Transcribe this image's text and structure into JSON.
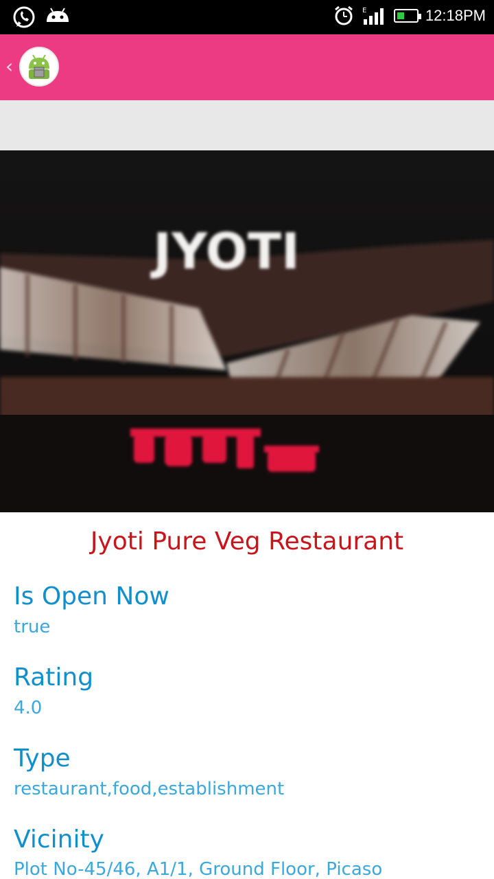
{
  "status_bar": {
    "time": "12:18PM",
    "icons": [
      "whatsapp-icon",
      "android-notification-icon",
      "alarm-icon",
      "signal-icon",
      "battery-icon"
    ]
  },
  "action_bar": {
    "back_glyph": "‹",
    "app_icon": "android-box-icon",
    "color": "#ec3b83"
  },
  "hero": {
    "sign_text": "JYOTI"
  },
  "place": {
    "name": "Jyoti Pure Veg Restaurant",
    "fields": [
      {
        "label": "Is Open Now",
        "value": "true"
      },
      {
        "label": "Rating",
        "value": "4.0"
      },
      {
        "label": "Type",
        "value": "restaurant,food,establishment"
      },
      {
        "label": "Vicinity",
        "value": "Plot No-45/46, A1/1, Ground Floor, Picaso"
      }
    ]
  },
  "colors": {
    "title": "#c8141b",
    "label": "#118fcd",
    "value": "#3aa7dd"
  }
}
